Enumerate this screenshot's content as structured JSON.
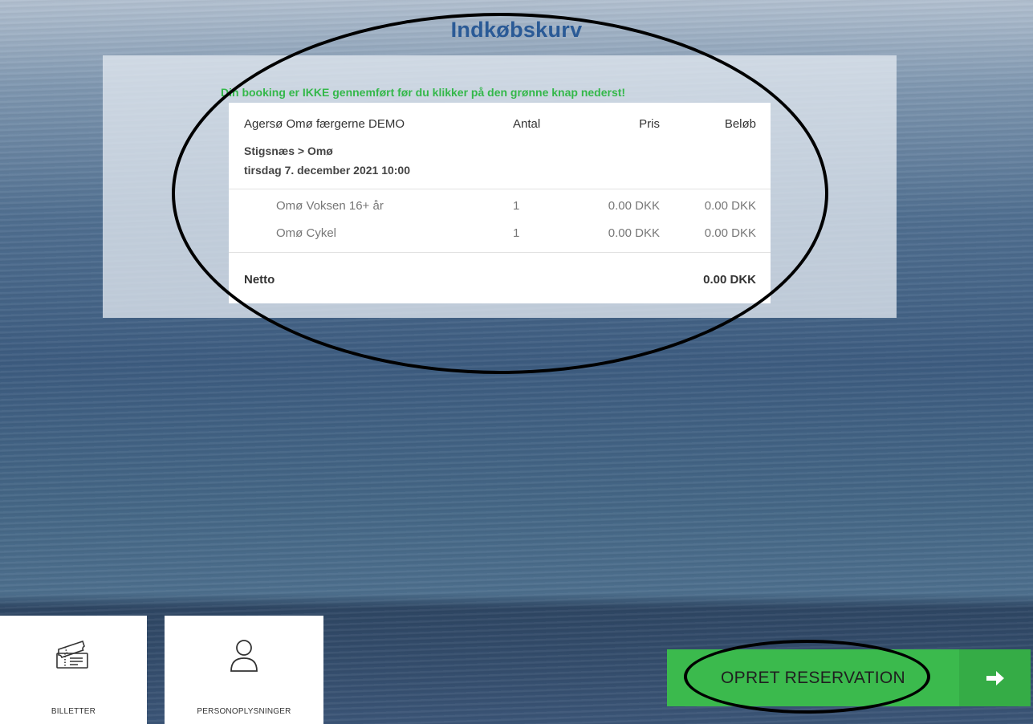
{
  "page": {
    "title": "Indkøbskurv",
    "warning": "Din booking er IKKE gennemført før du klikker på den grønne knap nederst!"
  },
  "cart": {
    "company": "Agersø Omø færgerne DEMO",
    "columns": {
      "qty": "Antal",
      "price": "Pris",
      "amount": "Beløb"
    },
    "route": "Stigsnæs > Omø",
    "departure": "tirsdag 7. december 2021 10:00",
    "items": [
      {
        "name": "Omø Voksen 16+ år",
        "qty": "1",
        "price": "0.00 DKK",
        "amount": "0.00 DKK"
      },
      {
        "name": "Omø Cykel",
        "qty": "1",
        "price": "0.00 DKK",
        "amount": "0.00 DKK"
      }
    ],
    "net_label": "Netto",
    "net_value": "0.00 DKK"
  },
  "tabs": [
    {
      "label": "BILLETTER",
      "icon": "ticket-icon"
    },
    {
      "label": "PERSONOPLYSNINGER",
      "icon": "user-icon"
    }
  ],
  "cta": {
    "label": "OPRET RESERVATION",
    "icon": "arrow-right-icon"
  },
  "colors": {
    "title": "#2a5a96",
    "warning": "#34b84a",
    "cta": "#3bba4d",
    "cta_arrow": "#35ac46"
  }
}
